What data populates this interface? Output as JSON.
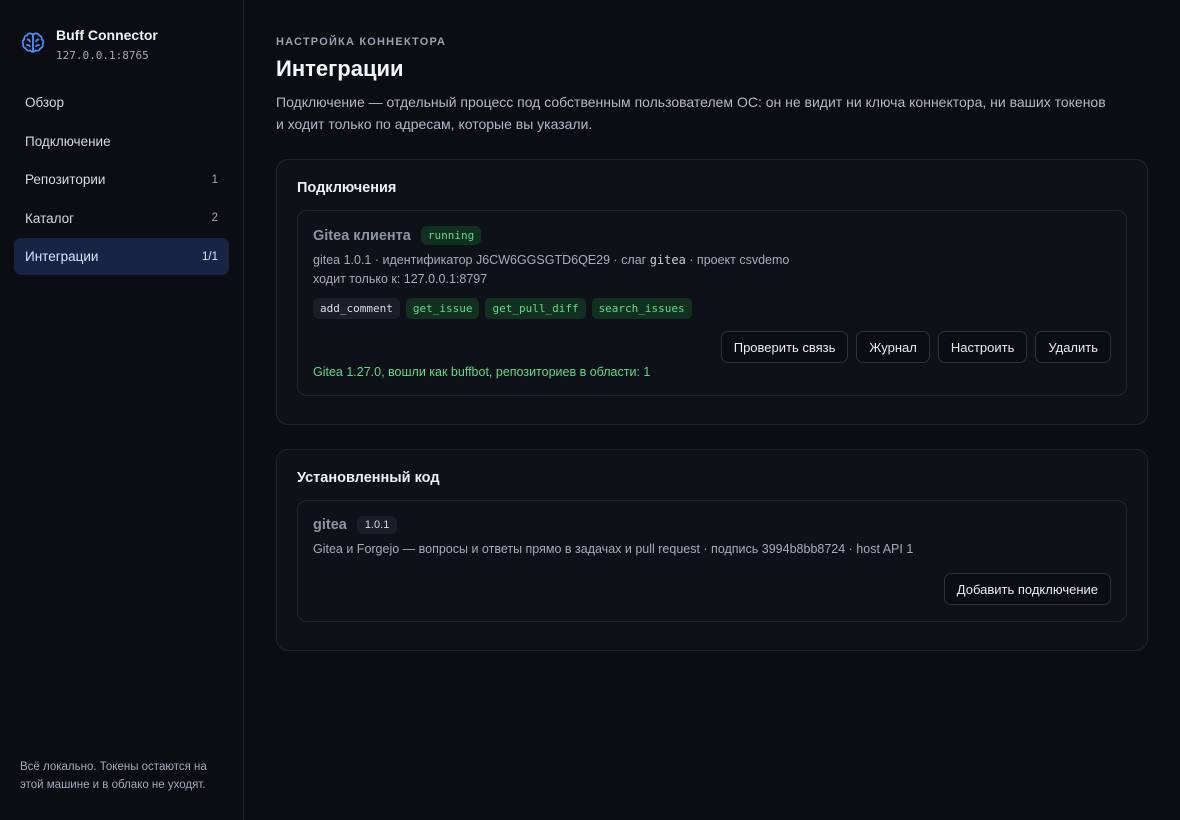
{
  "sidebar": {
    "brand": {
      "title": "Buff Connector",
      "address": "127.0.0.1:8765"
    },
    "items": [
      {
        "label": "Обзор",
        "count": ""
      },
      {
        "label": "Подключение",
        "count": ""
      },
      {
        "label": "Репозитории",
        "count": "1"
      },
      {
        "label": "Каталог",
        "count": "2"
      },
      {
        "label": "Интеграции",
        "count": "1/1",
        "active": true
      }
    ],
    "footer": "Всё локально. Токены остаются на этой машине и в облако не уходят."
  },
  "header": {
    "eyebrow": "НАСТРОЙКА КОННЕКТОРА",
    "title": "Интеграции",
    "description": "Подключение — отдельный процесс под собственным пользователем ОС: он не видит ни ключа коннектора, ни ваших токенов и ходит только по адресам, которые вы указали."
  },
  "connections": {
    "title": "Подключения",
    "card": {
      "name": "Gitea клиента",
      "status": "running",
      "meta_prefix": "gitea 1.0.1 · идентификатор J6CW6GGSGTD6QE29 · слаг ",
      "slug": "gitea",
      "meta_suffix": " · проект csvdemo",
      "allowed": "ходит только к: 127.0.0.1:8797",
      "tags": [
        {
          "label": "add_comment",
          "style": "neutral"
        },
        {
          "label": "get_issue",
          "style": "green"
        },
        {
          "label": "get_pull_diff",
          "style": "green"
        },
        {
          "label": "search_issues",
          "style": "green"
        }
      ],
      "buttons": {
        "check": "Проверить связь",
        "log": "Журнал",
        "configure": "Настроить",
        "delete": "Удалить"
      },
      "status_line": "Gitea 1.27.0, вошли как buffbot, репозиториев в области: 1"
    }
  },
  "installed": {
    "title": "Установленный код",
    "card": {
      "name": "gitea",
      "version": "1.0.1",
      "description": "Gitea и Forgejo — вопросы и ответы прямо в задачах и pull request · подпись 3994b8bb8724 · host API 1",
      "add_button": "Добавить подключение"
    }
  },
  "colors": {
    "accent": "#4f8cff",
    "active_bg": "#172444",
    "success": "#5fd98a",
    "background": "#0b0d12"
  },
  "icons": {
    "brand": "brain-icon"
  }
}
